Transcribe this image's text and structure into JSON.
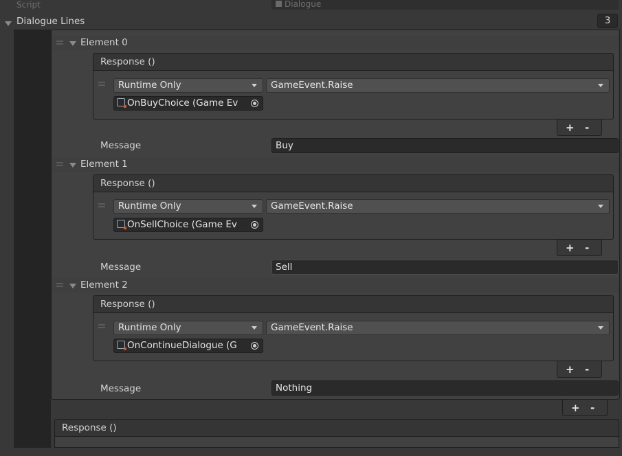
{
  "script": {
    "label": "Script",
    "value": "Dialogue"
  },
  "dialogue_lines": {
    "label": "Dialogue Lines",
    "size": "3",
    "elements": [
      {
        "title": "Element 0",
        "event_header": "Response ()",
        "mode": "Runtime Only",
        "function": "GameEvent.Raise",
        "object": "OnBuyChoice (Game Ev",
        "message_label": "Message",
        "message_value": "Buy"
      },
      {
        "title": "Element 1",
        "event_header": "Response ()",
        "mode": "Runtime Only",
        "function": "GameEvent.Raise",
        "object": "OnSellChoice (Game Ev",
        "message_label": "Message",
        "message_value": "Sell"
      },
      {
        "title": "Element 2",
        "event_header": "Response ()",
        "mode": "Runtime Only",
        "function": "GameEvent.Raise",
        "object": "OnContinueDialogue (G",
        "message_label": "Message",
        "message_value": "Nothing"
      }
    ]
  },
  "list_controls": {
    "add": "+",
    "remove": "-"
  },
  "response_bottom": {
    "header": "Response ()"
  },
  "icons": [
    "foldout-triangle-icon",
    "drag-handle-icon",
    "game-event-asset-icon",
    "object-picker-icon",
    "dropdown-caret-icon"
  ],
  "colors": {
    "background": "#383838",
    "panel": "#414141",
    "field": "#2a2a2a",
    "dropdown": "#505050",
    "text": "#d2d2d2"
  }
}
